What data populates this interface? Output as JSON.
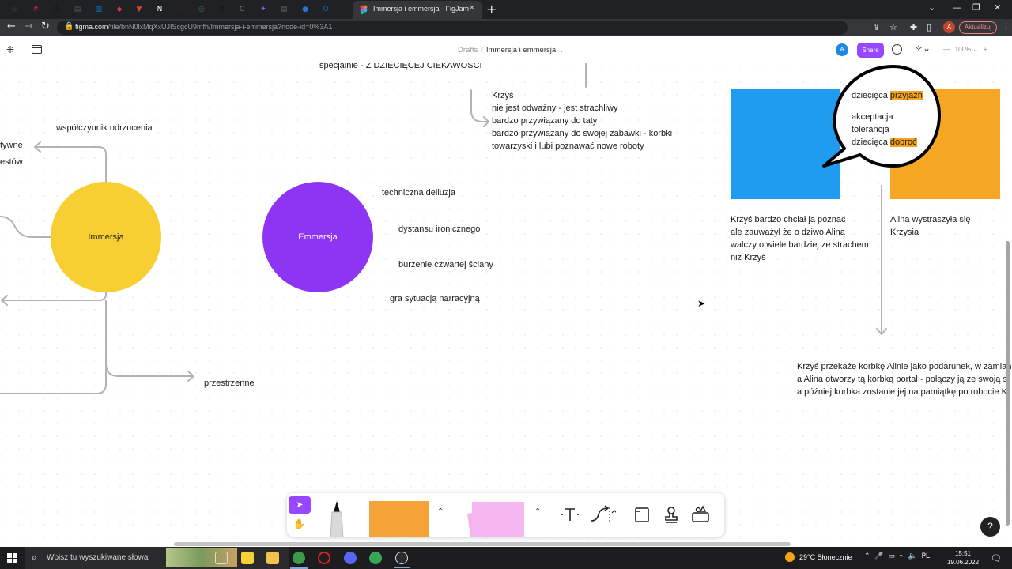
{
  "browser": {
    "active_tab_title": "Immersja i emmersja - FigJam",
    "url_host": "figma.com",
    "url_path": "/file/bnN0lxMqXxUJIScgcU9mfh/Immersja-i-emmersja?node-id=0%3A1",
    "profile_initial": "A",
    "update_label": "Aktualizuj",
    "tab_icons": [
      {
        "name": "chrome-tab-icon",
        "glyph": "G",
        "color": "#3c3c3c"
      },
      {
        "name": "slack-tab-icon",
        "glyph": "#",
        "color": "#e01e5a"
      },
      {
        "name": "tab-a-icon",
        "glyph": "A",
        "color": "#111111"
      },
      {
        "name": "tab-doc-icon",
        "glyph": "▤",
        "color": "#555555"
      },
      {
        "name": "trello-tab-icon",
        "glyph": "▥",
        "color": "#0079bf"
      },
      {
        "name": "tab-red-icon",
        "glyph": "◆",
        "color": "#d93a3a"
      },
      {
        "name": "gitlab-tab-icon",
        "glyph": "▼",
        "color": "#e24329"
      },
      {
        "name": "notion-tab-icon",
        "glyph": "N",
        "color": "#ffffff"
      },
      {
        "name": "tab-line-icon",
        "glyph": "—",
        "color": "#c0392b"
      },
      {
        "name": "tab-globe-icon",
        "glyph": "◎",
        "color": "#3a7d44"
      },
      {
        "name": "tab-a2-icon",
        "glyph": "A",
        "color": "#111111"
      },
      {
        "name": "tab-cs-icon",
        "glyph": "C",
        "color": "#777777"
      },
      {
        "name": "figma-tab-icon",
        "glyph": "✦",
        "color": "#a259ff"
      },
      {
        "name": "tab-doc2-icon",
        "glyph": "▤",
        "color": "#666666"
      },
      {
        "name": "tab-blue-icon",
        "glyph": "●",
        "color": "#2f6fd6"
      },
      {
        "name": "outlook-tab-icon",
        "glyph": "O",
        "color": "#0f6cbd"
      }
    ]
  },
  "figjam": {
    "breadcrumb_drafts": "Drafts",
    "breadcrumb_sep": "/",
    "file_name": "Immersja i emmersja",
    "avatar_initial": "A",
    "share_label": "Share",
    "zoom": "100%"
  },
  "canvas": {
    "texts": {
      "top_cut": "specjalnie - Z DZIECIĘCEJ CIEKAWOŚCI",
      "wspolczynnik": "współczynnik odrzucenia",
      "tywne": "tywne",
      "estow": "estów",
      "techniczna": "techniczna deiluzja",
      "dystansu": "dystansu ironicznego",
      "burzenie": "burzenie czwartej ściany",
      "gra": "gra sytuacją narracyjną",
      "przestrzenne": "przestrzenne"
    },
    "krzys_list": [
      "Krzyś",
      "nie jest odważny - jest strachliwy",
      "bardzo przywiązany do taty",
      "bardzo przywiązany do swojej zabawki - korbki",
      "towarzyski i lubi poznawać nowe roboty"
    ],
    "circle_immersja": "Immersja",
    "circle_emmersja": "Emmersja",
    "speech": {
      "line1_prefix": "dziecięca ",
      "line1_highlight": "przyjaźń",
      "line2": "akceptacja",
      "line3": "tolerancja",
      "line4_prefix": "dziecięca ",
      "line4_highlight": "dobroć"
    },
    "caption_blue": [
      "Krzyś bardzo chciał ją poznać",
      "ale zauważył że o dziwo Alina",
      "walczy o wiele bardziej ze strachem",
      "niż Krzyś"
    ],
    "caption_orange": [
      "Alina wystraszyła się",
      "Krzysia"
    ],
    "bottom_right": [
      "Krzyś przekaże korbkę Alinie jako podarunek, w zamian",
      "a Alina otworzy tą korbką portal - połączy ją ze swoją s",
      "a później korbka zostanie jej na pamiątkę po robocie K"
    ],
    "help": "?"
  },
  "colors": {
    "accent": "#9747ff",
    "yellow_circle": "#f7cf33",
    "purple_circle": "#8e34f3",
    "blue_sticky": "#1f9cf0",
    "orange_sticky": "#f5a623",
    "connector": "#b3b3b3"
  },
  "taskbar": {
    "search_placeholder": "Wpisz tu wyszukiwane słowa",
    "weather": "29°C  Słonecznie",
    "time": "15:51",
    "date": "19.06.2022"
  }
}
